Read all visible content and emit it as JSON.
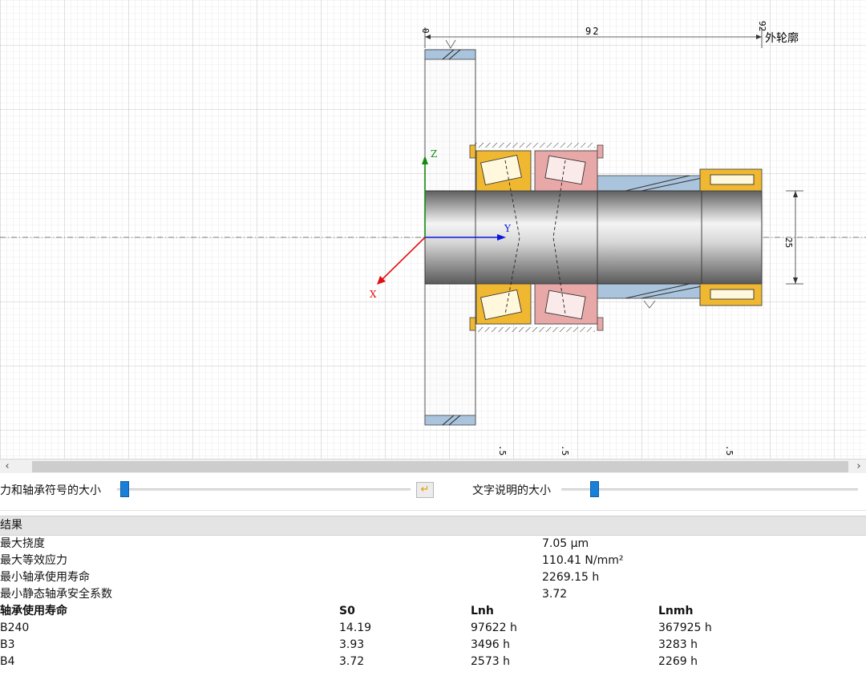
{
  "drawing": {
    "dim_top_left": "0",
    "dim_top_value": "92",
    "dim_top_right": "92",
    "outer_contour_label": "外轮廓",
    "dim_diameter": "25",
    "axis_x": "X",
    "axis_y": "Y",
    "axis_z": "Z",
    "bottom_marks": [
      ".5",
      ".5",
      ".5"
    ]
  },
  "controls": {
    "force_symbol_size_label": "力和轴承符号的大小",
    "force_symbol_size_value": 0.01,
    "text_size_label": "文字说明的大小",
    "text_size_value": 0.1
  },
  "results": {
    "header": "结果",
    "summary": [
      {
        "label": "最大挠度",
        "value": "7.05 µm"
      },
      {
        "label": "最大等效应力",
        "value": "110.41 N/mm²"
      },
      {
        "label": "最小轴承使用寿命",
        "value": "2269.15 h"
      },
      {
        "label": "最小静态轴承安全系数",
        "value": "3.72"
      }
    ],
    "bearing_table": {
      "headers": [
        "轴承使用寿命",
        "S0",
        "Lnh",
        "Lnmh"
      ],
      "rows": [
        [
          "B240",
          "14.19",
          "97622 h",
          "367925 h"
        ],
        [
          "B3",
          "3.93",
          "3496 h",
          "3283 h"
        ],
        [
          "B4",
          "3.72",
          "2573 h",
          "2269 h"
        ]
      ]
    }
  },
  "colors": {
    "bearing_yellow": "#f0b830",
    "bearing_pink": "#e8a8a8",
    "hub_blue": "#a9c4dc",
    "axis_x": "#e01010",
    "axis_y": "#0818e0",
    "axis_z": "#108a10",
    "slider_thumb": "#1a7fd8"
  }
}
